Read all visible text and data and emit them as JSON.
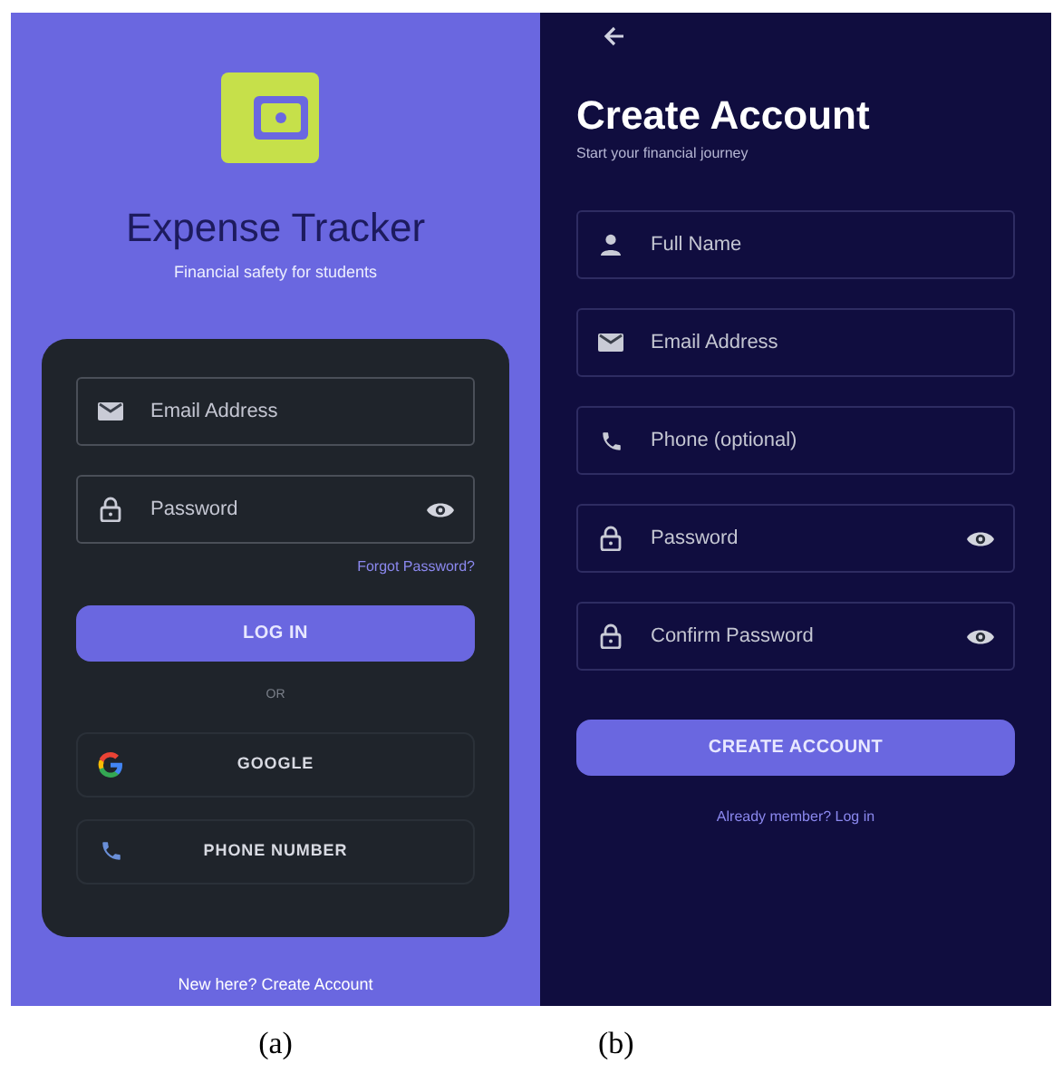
{
  "login_screen": {
    "title": "Expense Tracker",
    "subtitle": "Financial safety for students",
    "fields": [
      {
        "kind": "email",
        "placeholder": "Email Address"
      },
      {
        "kind": "password",
        "placeholder": "Password"
      }
    ],
    "forgot_link": "Forgot Password?",
    "login_button": "LOG IN",
    "divider": "OR",
    "alt_buttons": [
      {
        "kind": "google",
        "label": "GOOGLE"
      },
      {
        "kind": "phone",
        "label": "PHONE NUMBER"
      }
    ],
    "footer_link": "New here? Create Account",
    "caption": "(a)"
  },
  "signup_screen": {
    "title": "Create Account",
    "subtitle": "Start your financial journey",
    "fields": [
      {
        "kind": "name",
        "placeholder": "Full Name"
      },
      {
        "kind": "email",
        "placeholder": "Email Address"
      },
      {
        "kind": "phone",
        "placeholder": "Phone (optional)"
      },
      {
        "kind": "password",
        "placeholder": "Password"
      },
      {
        "kind": "password",
        "placeholder": "Confirm Password"
      }
    ],
    "create_button": "CREATE ACCOUNT",
    "footer_link": "Already member? Log in",
    "caption": "(b)"
  }
}
